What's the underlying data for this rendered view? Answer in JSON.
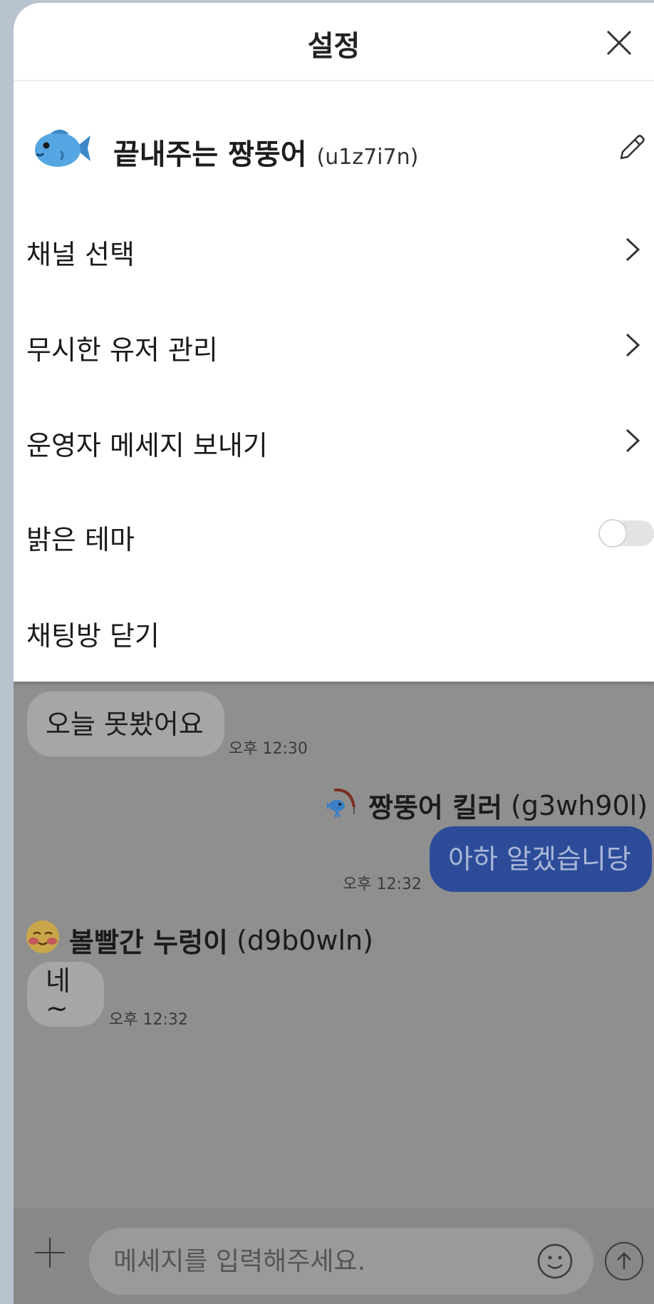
{
  "settings": {
    "title": "설정",
    "profile": {
      "emoji_icon": "fish-icon",
      "nickname": "끝내주는 짱뚱어",
      "user_id": "(u1z7i7n)"
    },
    "menu": [
      {
        "label": "채널 선택"
      },
      {
        "label": "무시한 유저 관리"
      },
      {
        "label": "운영자 메세지 보내기"
      },
      {
        "label": "밝은 테마",
        "toggle": false
      },
      {
        "label": "채팅방 닫기"
      }
    ]
  },
  "chat": {
    "messages": [
      {
        "text": "오늘 못봤어요",
        "time": "오후 12:30"
      },
      {
        "sender": "짱뚱어 킬러",
        "sender_id": "(g3wh90l)",
        "text": "아하 알겠습니당",
        "time": "오후 12:32"
      },
      {
        "sender": "볼빨간 누렁이",
        "sender_id": "(d9b0wln)",
        "text": "네~",
        "time": "오후 12:32"
      }
    ],
    "input": {
      "placeholder": "메세지를 입력해주세요."
    }
  },
  "colors": {
    "sheet_bg": "#ffffff",
    "dim_bg": "#8f8f8f",
    "my_bubble": "#2c4c99",
    "other_bubble": "#a6a6a6"
  }
}
